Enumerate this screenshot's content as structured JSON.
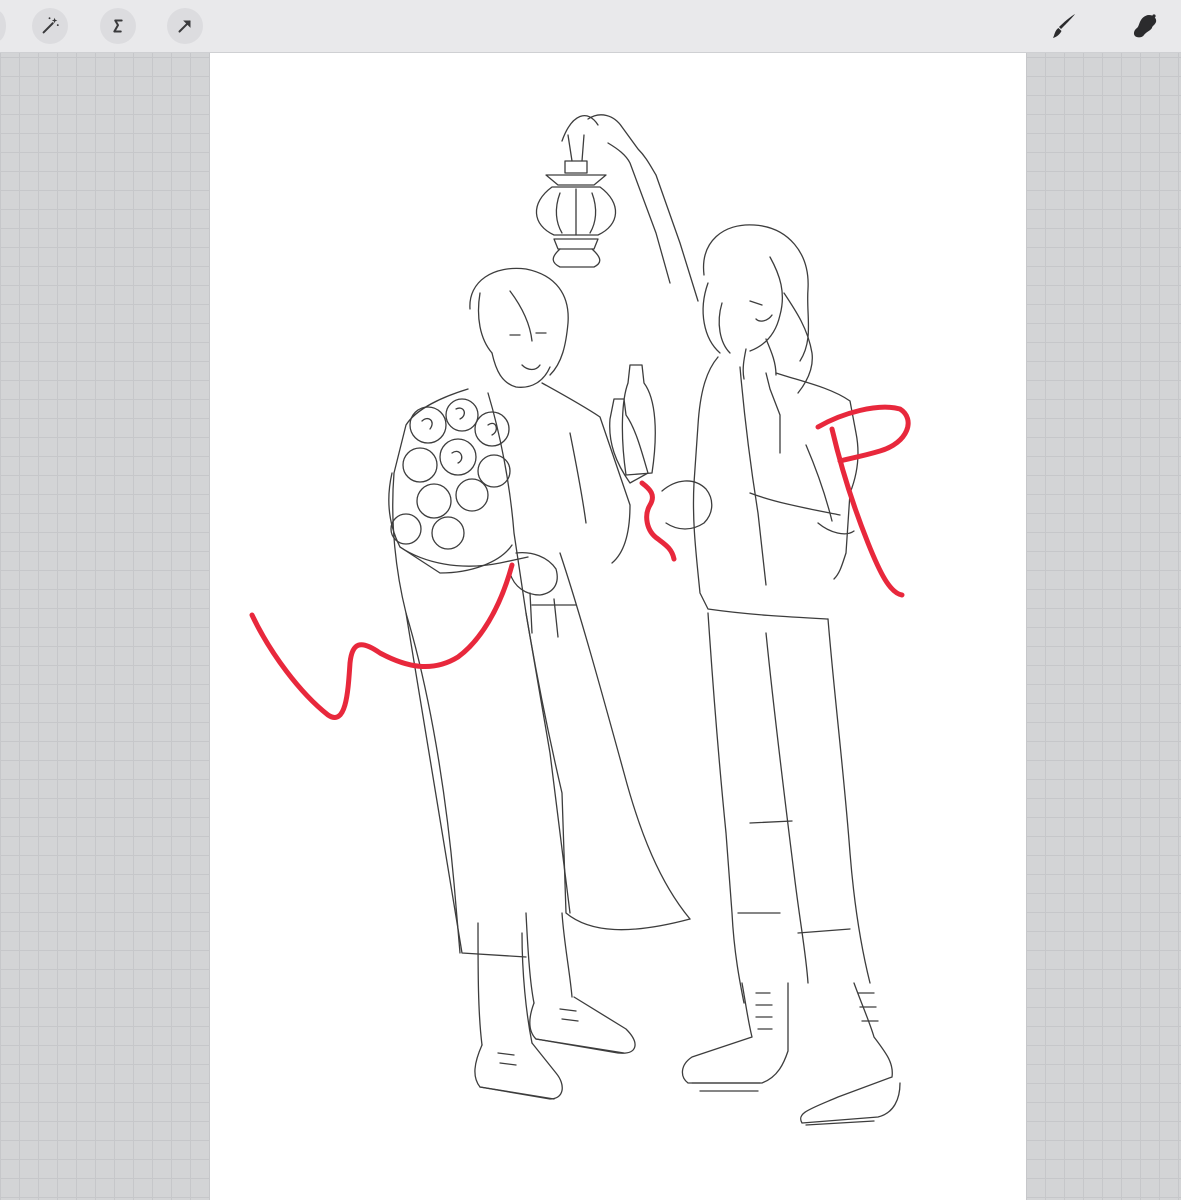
{
  "toolbar": {
    "left_tools": [
      {
        "name": "adjustments",
        "icon": "magic-wand-icon"
      },
      {
        "name": "selection",
        "icon": "selection-s-icon"
      },
      {
        "name": "transform",
        "icon": "arrow-cursor-icon"
      }
    ],
    "right_tools": [
      {
        "name": "brush",
        "icon": "brush-icon"
      },
      {
        "name": "smudge",
        "icon": "smudge-icon"
      }
    ]
  },
  "canvas": {
    "background": "#ffffff",
    "artwork": "line-art-sketch",
    "annotation_color": "#e8283c"
  },
  "colors": {
    "workspace": "#d3d4d6",
    "grid": "#c6c7ca",
    "toolbar": "#e9e9eb"
  }
}
